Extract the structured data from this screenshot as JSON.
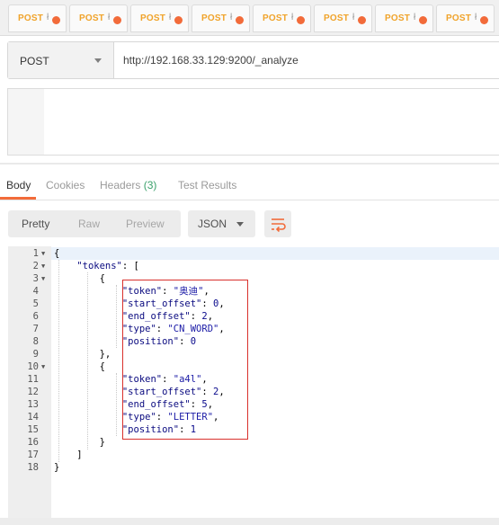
{
  "request_tabs": [
    {
      "method": "POST",
      "name_fragment": "ł"
    },
    {
      "method": "POST",
      "name_fragment": "ł"
    },
    {
      "method": "POST",
      "name_fragment": "ł"
    },
    {
      "method": "POST",
      "name_fragment": "ł"
    },
    {
      "method": "POST",
      "name_fragment": "ł"
    },
    {
      "method": "POST",
      "name_fragment": "ł"
    },
    {
      "method": "POST",
      "name_fragment": "ł"
    },
    {
      "method": "POST",
      "name_fragment": "ł"
    }
  ],
  "url_bar": {
    "method": "POST",
    "url": "http://192.168.33.129:9200/_analyze"
  },
  "response_tabs": {
    "body": "Body",
    "cookies": "Cookies",
    "headers": "Headers",
    "headers_count": "(3)",
    "test_results": "Test Results"
  },
  "view_modes": {
    "pretty": "Pretty",
    "raw": "Raw",
    "preview": "Preview",
    "format": "JSON"
  },
  "colors": {
    "accent": "#f26b3a",
    "method_post": "#f0a32a",
    "highlight_border": "#d9312d",
    "headers_count": "#3aa06b"
  },
  "response_lines": [
    {
      "n": "1",
      "fold": true,
      "code": "{"
    },
    {
      "n": "2",
      "fold": true,
      "code": "    \"tokens\": ["
    },
    {
      "n": "3",
      "fold": true,
      "code": "        {"
    },
    {
      "n": "4",
      "fold": false,
      "code": "            \"token\": \"奥迪\","
    },
    {
      "n": "5",
      "fold": false,
      "code": "            \"start_offset\": 0,"
    },
    {
      "n": "6",
      "fold": false,
      "code": "            \"end_offset\": 2,"
    },
    {
      "n": "7",
      "fold": false,
      "code": "            \"type\": \"CN_WORD\","
    },
    {
      "n": "8",
      "fold": false,
      "code": "            \"position\": 0"
    },
    {
      "n": "9",
      "fold": false,
      "code": "        },"
    },
    {
      "n": "10",
      "fold": true,
      "code": "        {"
    },
    {
      "n": "11",
      "fold": false,
      "code": "            \"token\": \"a4l\","
    },
    {
      "n": "12",
      "fold": false,
      "code": "            \"start_offset\": 2,"
    },
    {
      "n": "13",
      "fold": false,
      "code": "            \"end_offset\": 5,"
    },
    {
      "n": "14",
      "fold": false,
      "code": "            \"type\": \"LETTER\","
    },
    {
      "n": "15",
      "fold": false,
      "code": "            \"position\": 1"
    },
    {
      "n": "16",
      "fold": false,
      "code": "        }"
    },
    {
      "n": "17",
      "fold": false,
      "code": "    ]"
    },
    {
      "n": "18",
      "fold": false,
      "code": "}"
    }
  ]
}
